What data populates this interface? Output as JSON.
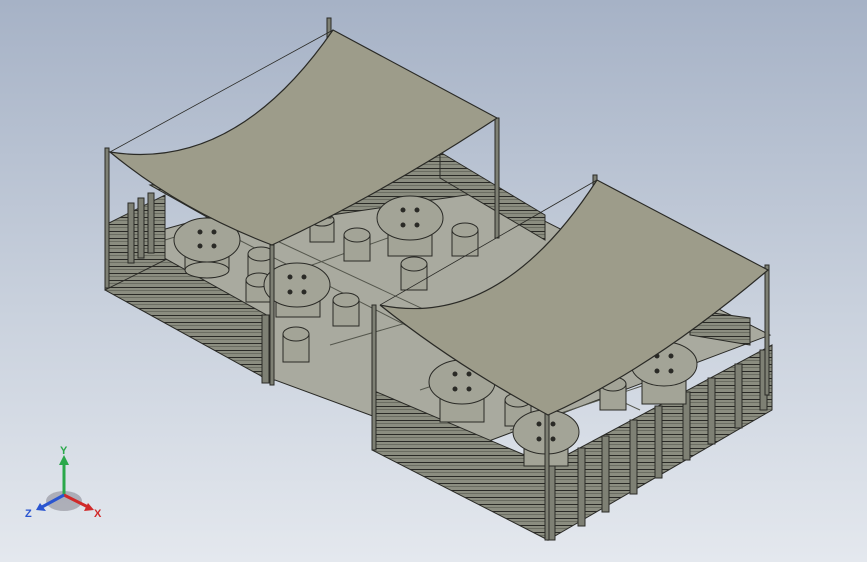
{
  "viewport": {
    "background_top": "#a6b2c6",
    "background_bottom": "#e4e8ee"
  },
  "model": {
    "description_icon": "outdoor-dining-terrace-3d-model",
    "canopy_color": "#9d9c8a",
    "floor_color": "#a9aa9f",
    "wood_color": "#8b8d80",
    "edge_color": "#2a2a26"
  },
  "triad": {
    "y_label": "Y",
    "x_label": "X",
    "z_label": "Z",
    "y_color": "#2aa84a",
    "x_color": "#d02a2a",
    "z_color": "#2a55d0"
  }
}
